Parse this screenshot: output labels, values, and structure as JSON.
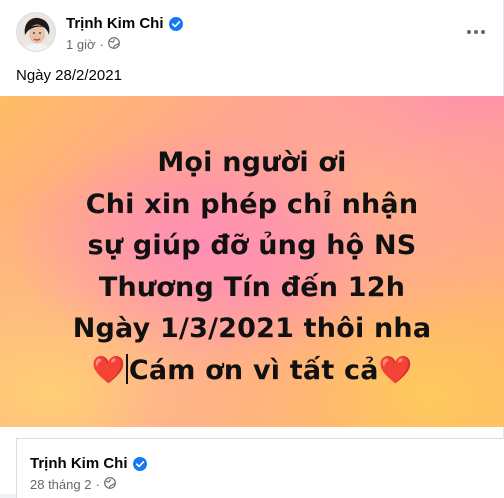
{
  "post": {
    "author_name": "Trịnh Kim Chi",
    "timestamp": "1 giờ",
    "separator": "·",
    "privacy_icon": "globe-icon",
    "more_icon": "more-horizontal-icon",
    "caption": "Ngày 28/2/2021"
  },
  "image": {
    "line1": "Mọi người ơi",
    "line2": "Chi xin phép chỉ nhận",
    "line3": "sự giúp đỡ ủng hộ NS",
    "line4": "Thương Tín đến 12h",
    "line5": "Ngày 1/3/2021 thôi nha",
    "heart_left": "❤️",
    "line6": "Cám ơn vì tất cả",
    "heart_right": "❤️"
  },
  "shared_post": {
    "author_name": "Trịnh Kim Chi",
    "timestamp": "28 tháng 2",
    "separator": "·",
    "privacy_icon": "globe-icon"
  },
  "colors": {
    "verified": "#1877f2",
    "meta_text": "#65676b"
  }
}
